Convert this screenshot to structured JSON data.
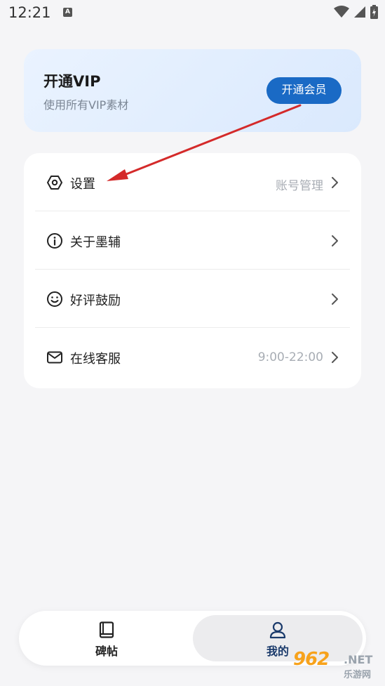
{
  "status_bar": {
    "time": "12:21",
    "notification_glyph": "A",
    "icons": [
      "wifi-icon",
      "cellular-signal-icon",
      "battery-charging-icon"
    ]
  },
  "vip_card": {
    "title": "开通VIP",
    "subtitle": "使用所有VIP素材",
    "button_label": "开通会员"
  },
  "menu": {
    "items": [
      {
        "icon": "settings-hexagon-icon",
        "label": "设置",
        "value": "账号管理"
      },
      {
        "icon": "info-icon",
        "label": "关于墨辅",
        "value": ""
      },
      {
        "icon": "smiley-icon",
        "label": "好评鼓励",
        "value": ""
      },
      {
        "icon": "mail-icon",
        "label": "在线客服",
        "value": "9:00-22:00"
      }
    ]
  },
  "bottom_nav": {
    "tabs": [
      {
        "icon": "book-icon",
        "label": "碑帖",
        "active": false
      },
      {
        "icon": "user-icon",
        "label": "我的",
        "active": true
      }
    ]
  },
  "watermark": {
    "logo": "962",
    "net": ".NET",
    "sub": "乐游网"
  },
  "colors": {
    "accent": "#1a6ac5",
    "annotation": "#d42a2a",
    "background": "#f5f5f7"
  }
}
